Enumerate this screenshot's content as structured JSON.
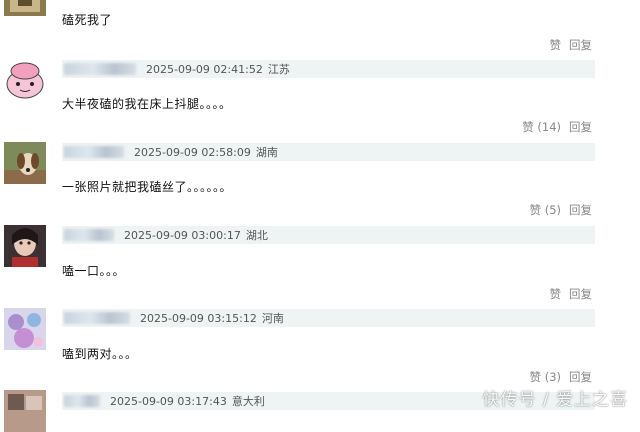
{
  "comments": [
    {
      "text": "磕死我了",
      "likes_label": "赞",
      "reply_label": "回复"
    },
    {
      "time": "2025-09-09 02:41:52",
      "location": "江苏",
      "text": "大半夜磕的我在床上抖腿。。。。",
      "likes_label": "赞 (14)",
      "reply_label": "回复"
    },
    {
      "time": "2025-09-09 02:58:09",
      "location": "湖南",
      "text": "一张照片就把我磕丝了。。。。。。",
      "likes_label": "赞 (5)",
      "reply_label": "回复"
    },
    {
      "time": "2025-09-09 03:00:17",
      "location": "湖北",
      "text": "嗑一口。。。",
      "likes_label": "赞",
      "reply_label": "回复"
    },
    {
      "time": "2025-09-09 03:15:12",
      "location": "河南",
      "text": "嗑到两对。。。",
      "likes_label": "赞 (3)",
      "reply_label": "回复"
    },
    {
      "time": "2025-09-09 03:17:43",
      "location": "意大利"
    }
  ],
  "watermark": "快传号 / 爱上之喜"
}
